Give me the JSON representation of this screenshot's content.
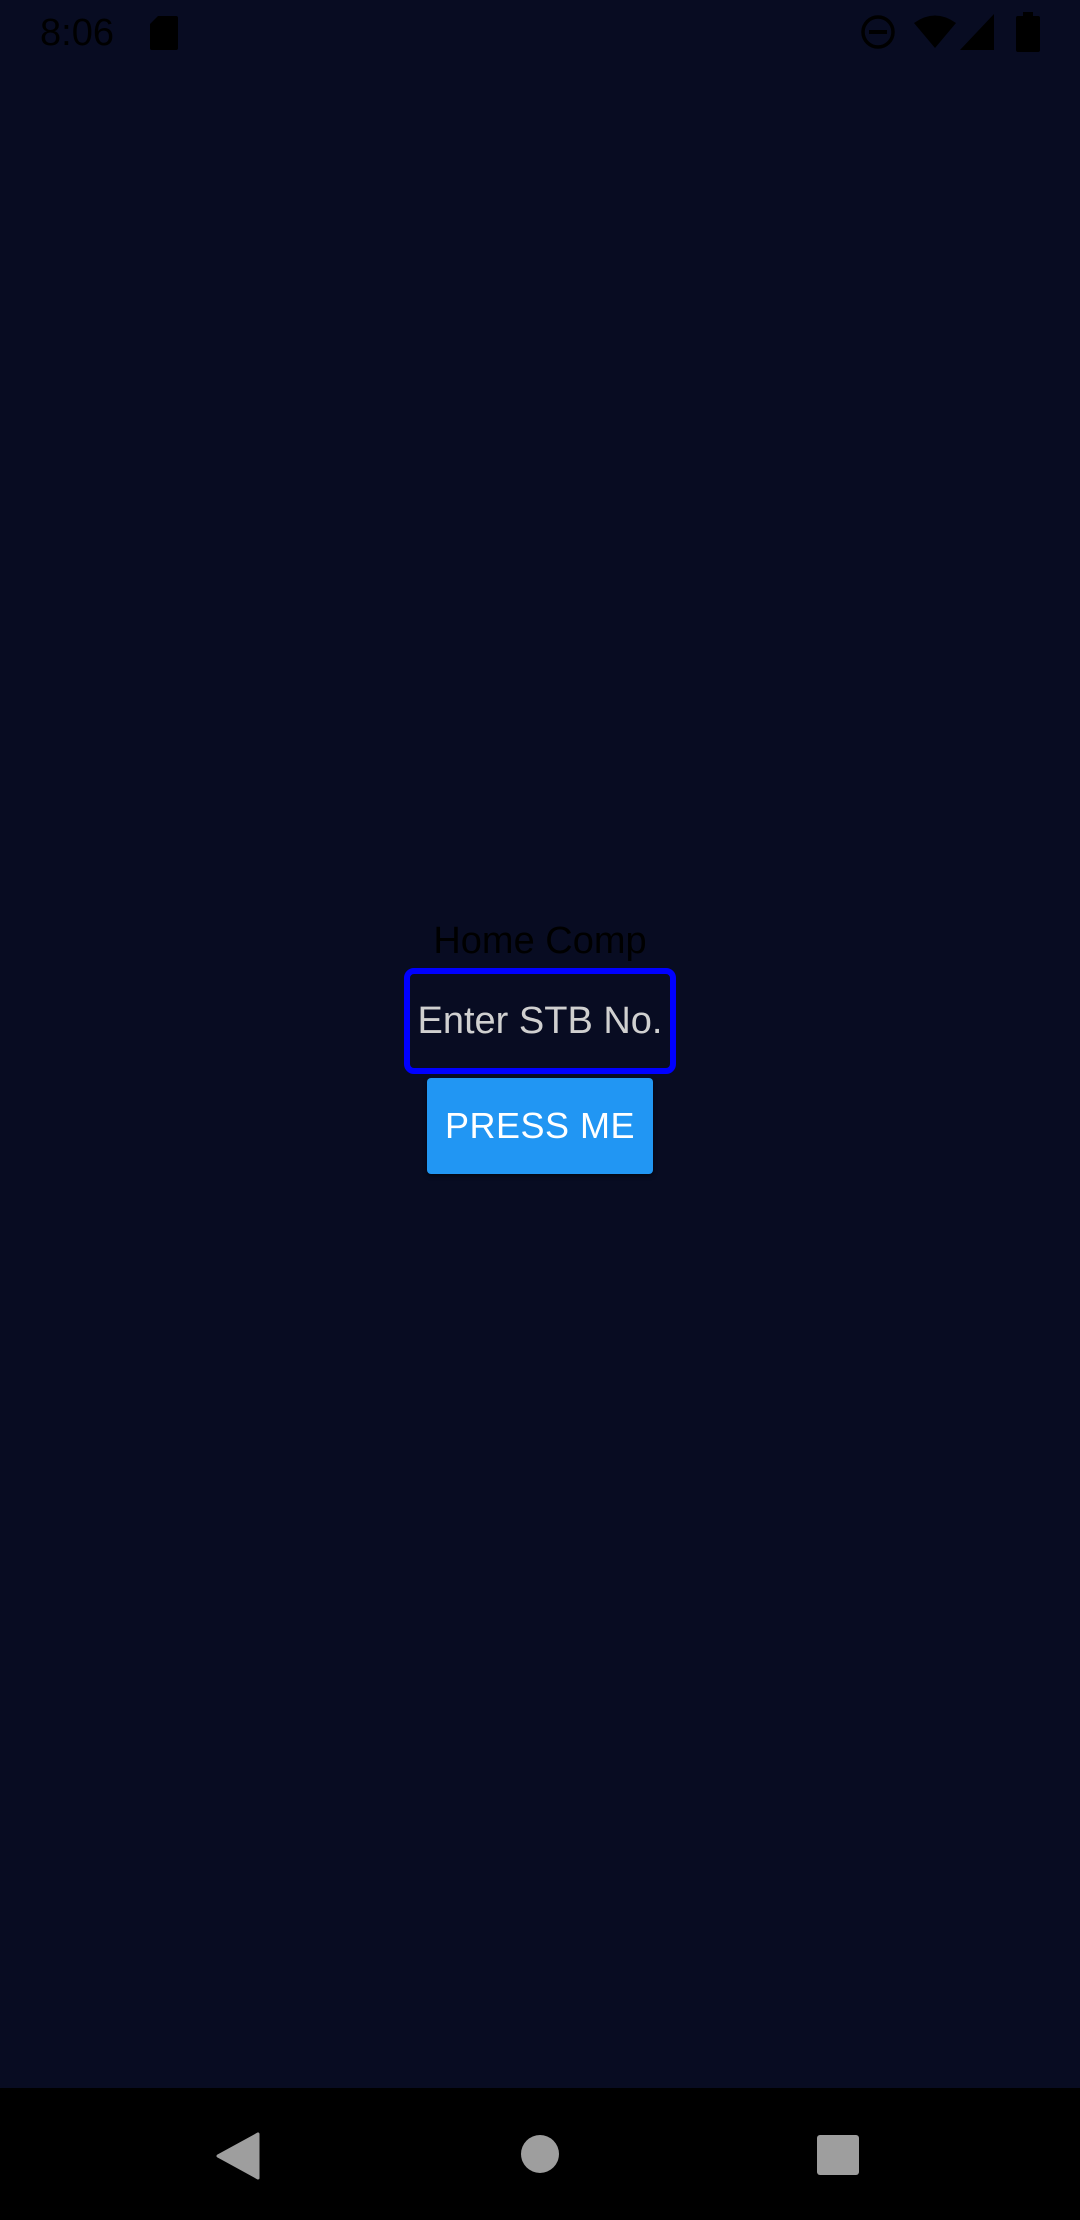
{
  "status_bar": {
    "time": "8:06",
    "icons": [
      "sd-card-icon",
      "do-not-disturb-icon",
      "wifi-icon",
      "signal-icon",
      "battery-icon"
    ]
  },
  "main": {
    "title": "Home Comp",
    "stb_input": {
      "value": "",
      "placeholder": "Enter STB No."
    },
    "button_label": "PRESS ME"
  },
  "nav_bar": {
    "icons": [
      "back-icon",
      "home-icon",
      "recents-icon"
    ]
  },
  "colors": {
    "background": "#080c22",
    "input_border": "#0000ff",
    "button": "#2196f3",
    "nav_bar": "#000000"
  }
}
